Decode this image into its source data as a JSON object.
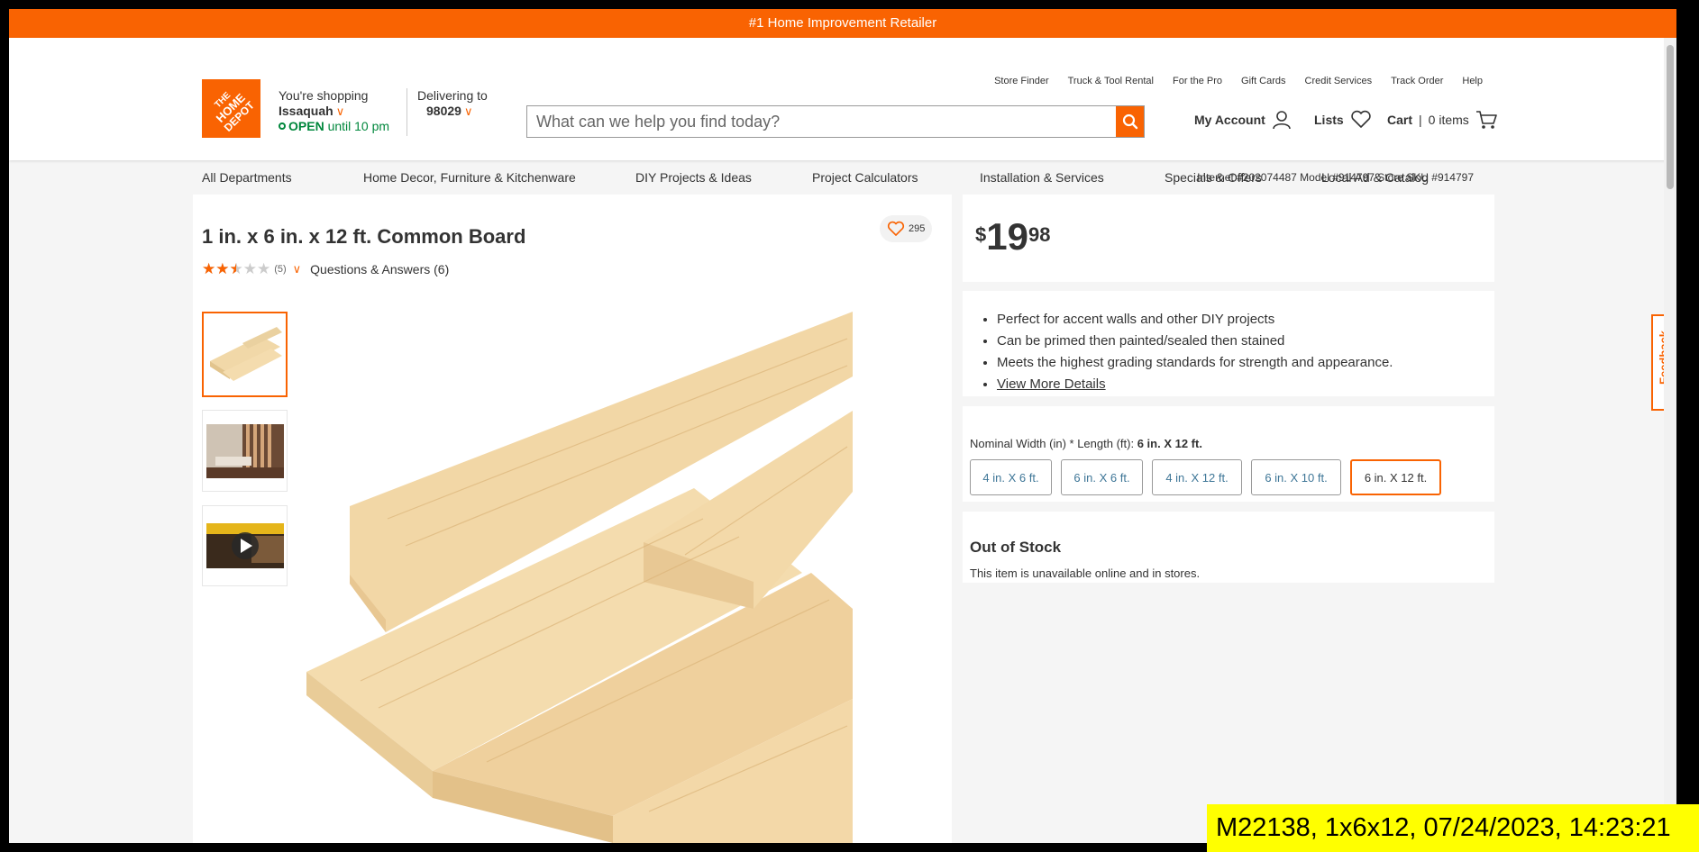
{
  "promo": {
    "text": "#1 Home Improvement Retailer"
  },
  "logo": {
    "line1": "THE",
    "line2": "HOME",
    "line3": "DEPOT"
  },
  "store": {
    "label": "You're shopping",
    "name": "Issaquah",
    "status": "OPEN",
    "hours": "until 10 pm"
  },
  "delivery": {
    "label": "Delivering to",
    "zip": "98029"
  },
  "utility_links": [
    "Store Finder",
    "Truck & Tool Rental",
    "For the Pro",
    "Gift Cards",
    "Credit Services",
    "Track Order",
    "Help"
  ],
  "search": {
    "placeholder": "What can we help you find today?"
  },
  "account": {
    "my_account": "My Account",
    "lists": "Lists",
    "cart": "Cart",
    "cart_sep": "|",
    "cart_count": "0 items"
  },
  "nav": [
    "All Departments",
    "Home Decor, Furniture & Kitchenware",
    "DIY Projects & Ideas",
    "Project Calculators",
    "Installation & Services",
    "Specials & Offers",
    "Local Ad & Catalog"
  ],
  "product": {
    "skus": "Internet #202074487   Model #914797   Store SKU #914797",
    "title": "1 in. x 6 in. x 12 ft. Common Board",
    "rating": 2.5,
    "review_count": "(5)",
    "qa": "Questions & Answers (6)",
    "favorites": "295",
    "price": {
      "currency": "$",
      "whole": "19",
      "fraction": "98"
    },
    "bullets": [
      "Perfect for accent walls and other DIY projects",
      "Can be primed then painted/sealed then stained",
      "Meets the highest grading standards for strength and appearance."
    ],
    "view_more": "View More Details",
    "option_label": "Nominal Width (in) * Length (ft):",
    "option_selected": "6 in. X 12 ft.",
    "options": [
      "4 in. X 6 ft.",
      "6 in. X 6 ft.",
      "4 in. X 12 ft.",
      "6 in. X 10 ft.",
      "6 in. X 12 ft."
    ],
    "stock_title": "Out of Stock",
    "stock_text": "This item is unavailable online and in stores."
  },
  "feedback": {
    "label": "Feedback"
  },
  "stamp": {
    "text": "M22138, 1x6x12, 07/24/2023, 14:23:21"
  },
  "colors": {
    "brand": "#f96302",
    "open": "#00873c",
    "option_link": "#3e7697",
    "stamp_bg": "#ffff00"
  }
}
